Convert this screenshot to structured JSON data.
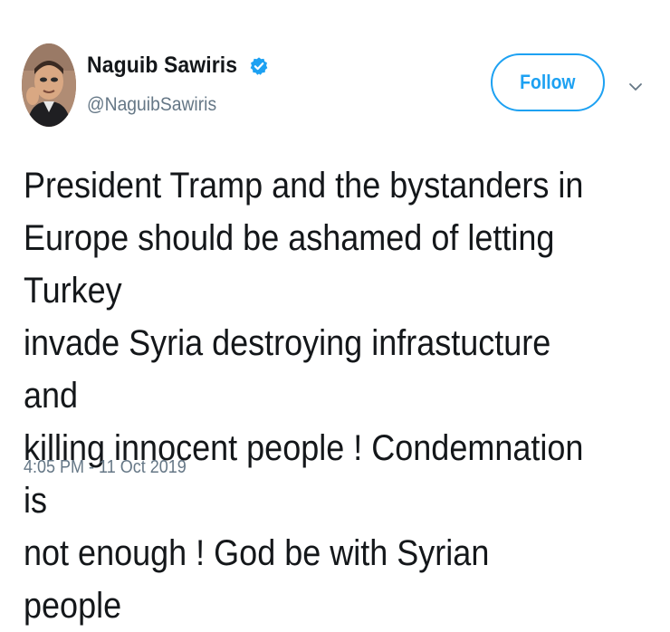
{
  "user": {
    "display_name": "Naguib Sawiris",
    "handle": "@NaguibSawiris",
    "verified": true
  },
  "actions": {
    "follow_label": "Follow",
    "more_icon": "chevron-down-icon"
  },
  "tweet": {
    "text": "President Tramp and the bystanders in\nEurope  should be ashamed of letting Turkey\ninvade Syria destroying infrastucture and\nkilling innocent people !  Condemnation is\nnot enough ! God be with Syrian people",
    "timestamp": "4:05 PM - 11 Oct 2019"
  },
  "colors": {
    "accent": "#1da1f2",
    "text": "#14171a",
    "muted": "#657786"
  }
}
